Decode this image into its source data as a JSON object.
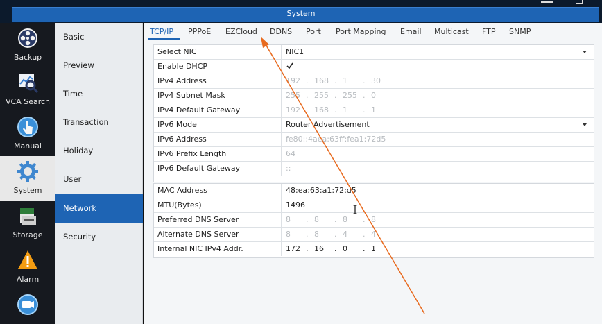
{
  "window": {
    "title": "System"
  },
  "rail": [
    {
      "label": "Backup",
      "icon": "film-reel-icon"
    },
    {
      "label": "VCA Search",
      "icon": "chart-search-icon"
    },
    {
      "label": "Manual",
      "icon": "hand-touch-icon"
    },
    {
      "label": "System",
      "icon": "gear-icon",
      "active": true
    },
    {
      "label": "Storage",
      "icon": "storage-icon"
    },
    {
      "label": "Alarm",
      "icon": "alarm-warning-icon"
    },
    {
      "label": "",
      "icon": "camera-icon"
    }
  ],
  "submenu": [
    {
      "label": "Basic"
    },
    {
      "label": "Preview"
    },
    {
      "label": "Time"
    },
    {
      "label": "Transaction"
    },
    {
      "label": "Holiday"
    },
    {
      "label": "User"
    },
    {
      "label": "Network",
      "active": true
    },
    {
      "label": "Security"
    }
  ],
  "tabs": [
    {
      "label": "TCP/IP",
      "active": true
    },
    {
      "label": "PPPoE"
    },
    {
      "label": "EZCloud"
    },
    {
      "label": "DDNS"
    },
    {
      "label": "Port"
    },
    {
      "label": "Port Mapping"
    },
    {
      "label": "Email"
    },
    {
      "label": "Multicast"
    },
    {
      "label": "FTP"
    },
    {
      "label": "SNMP"
    }
  ],
  "form1": {
    "select_nic": {
      "label": "Select NIC",
      "value": "NIC1"
    },
    "enable_dhcp": {
      "label": "Enable DHCP",
      "checked": true
    },
    "ipv4_address": {
      "label": "IPv4 Address",
      "octets": [
        "192",
        "168",
        "1",
        "30"
      ]
    },
    "ipv4_mask": {
      "label": "IPv4 Subnet Mask",
      "octets": [
        "255",
        "255",
        "255",
        "0"
      ]
    },
    "ipv4_gateway": {
      "label": "IPv4 Default Gateway",
      "octets": [
        "192",
        "168",
        "1",
        "1"
      ]
    },
    "ipv6_mode": {
      "label": "IPv6 Mode",
      "value": "Router Advertisement"
    },
    "ipv6_address": {
      "label": "IPv6 Address",
      "value": "fe80::4aea:63ff:fea1:72d5"
    },
    "ipv6_prefix": {
      "label": "IPv6 Prefix Length",
      "value": "64"
    },
    "ipv6_gateway": {
      "label": "IPv6 Default Gateway",
      "value": "::"
    }
  },
  "form2": {
    "mac": {
      "label": "MAC Address",
      "value": "48:ea:63:a1:72:d5"
    },
    "mtu": {
      "label": "MTU(Bytes)",
      "value": "1496"
    },
    "dns1": {
      "label": "Preferred DNS Server",
      "octets": [
        "8",
        "8",
        "8",
        "8"
      ]
    },
    "dns2": {
      "label": "Alternate DNS Server",
      "octets": [
        "8",
        "8",
        "4",
        "4"
      ]
    },
    "internal_nic": {
      "label": "Internal NIC IPv4 Addr.",
      "octets": [
        "172",
        "16",
        "0",
        "1"
      ]
    }
  },
  "colors": {
    "accent": "#1e64b4",
    "annotation_arrow": "#e86a1e"
  }
}
